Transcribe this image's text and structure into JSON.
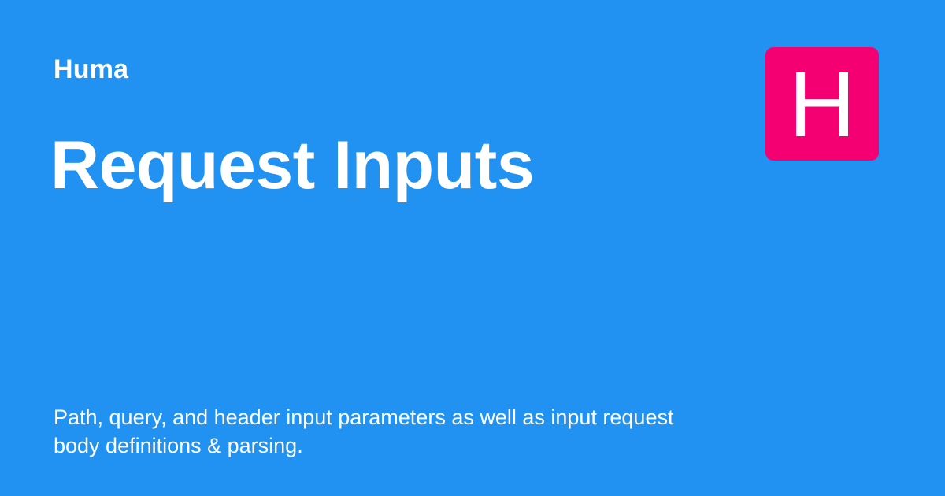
{
  "site_name": "Huma",
  "page_title": "Request Inputs",
  "description": "Path, query, and header input parameters as well as input request body definitions & parsing.",
  "logo": {
    "letter": "H"
  },
  "colors": {
    "background": "#2192f2",
    "logo_background": "#f50072",
    "text": "#ffffff"
  }
}
